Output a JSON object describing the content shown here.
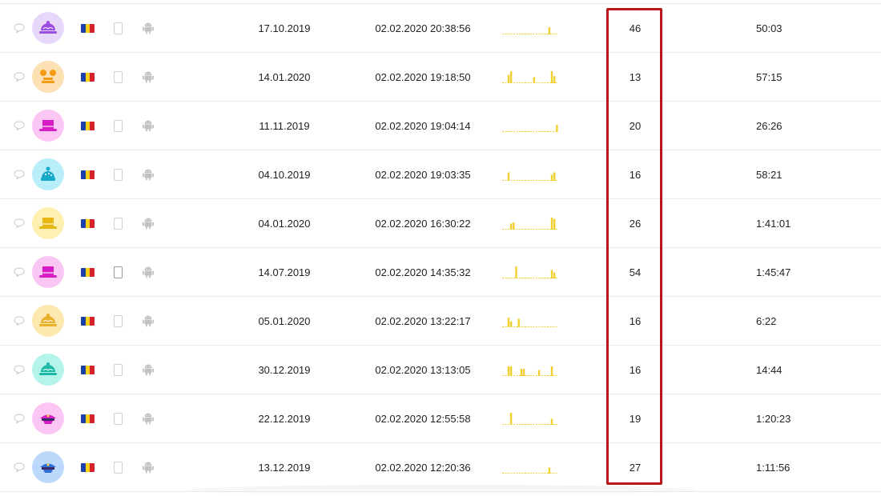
{
  "rows": [
    {
      "first_seen": "17.10.2019",
      "last_seen": "02.02.2020 20:38:56",
      "sessions": "46",
      "duration": "50:03",
      "avatar_color": "#e7d7fb",
      "avatar_fg": "#9a4be0",
      "avatar_icon": "cake-hat-icon",
      "device_active": false,
      "activity": [
        0,
        0,
        0,
        0,
        0,
        0,
        0,
        0,
        0,
        0,
        0,
        0,
        0,
        0,
        0,
        0,
        0,
        0,
        0.6,
        0,
        0,
        0
      ]
    },
    {
      "first_seen": "14.01.2020",
      "last_seen": "02.02.2020 19:18:50",
      "sessions": "13",
      "duration": "57:15",
      "avatar_color": "#fde0b3",
      "avatar_fg": "#f39b12",
      "avatar_icon": "mouse-ears-hat-icon",
      "device_active": false,
      "activity": [
        0,
        0,
        0.7,
        1,
        0,
        0,
        0,
        0,
        0,
        0,
        0,
        0,
        0.5,
        0,
        0,
        0,
        0,
        0,
        0,
        1,
        0.6,
        0
      ]
    },
    {
      "first_seen": "11.11.2019",
      "last_seen": "02.02.2020 19:04:14",
      "sessions": "20",
      "duration": "26:26",
      "avatar_color": "#fbc6f3",
      "avatar_fg": "#d61cc4",
      "avatar_icon": "fedora-hat-icon",
      "device_active": false,
      "activity": [
        0,
        0,
        0,
        0,
        0,
        0,
        0,
        0,
        0,
        0,
        0,
        0,
        0,
        0,
        0,
        0,
        0,
        0,
        0,
        0,
        0,
        0.6
      ]
    },
    {
      "first_seen": "04.10.2019",
      "last_seen": "02.02.2020 19:03:35",
      "sessions": "16",
      "duration": "58:21",
      "avatar_color": "#b8eefa",
      "avatar_fg": "#1aa8c9",
      "avatar_icon": "beanie-hat-icon",
      "device_active": false,
      "activity": [
        0,
        0,
        0.7,
        0,
        0,
        0,
        0,
        0,
        0,
        0,
        0,
        0,
        0,
        0,
        0,
        0,
        0,
        0,
        0,
        0.5,
        0.7,
        0
      ]
    },
    {
      "first_seen": "04.01.2020",
      "last_seen": "02.02.2020 16:30:22",
      "sessions": "26",
      "duration": "1:41:01",
      "avatar_color": "#fdf0b0",
      "avatar_fg": "#e6b710",
      "avatar_icon": "top-hat-icon",
      "device_active": false,
      "activity": [
        0,
        0,
        0,
        0.5,
        0.6,
        0,
        0,
        0,
        0,
        0,
        0,
        0,
        0,
        0,
        0,
        0,
        0,
        0,
        0,
        1,
        0.9,
        0
      ]
    },
    {
      "first_seen": "14.07.2019",
      "last_seen": "02.02.2020 14:35:32",
      "sessions": "54",
      "duration": "1:45:47",
      "avatar_color": "#fbc6f3",
      "avatar_fg": "#d61cc4",
      "avatar_icon": "top-hat-icon",
      "device_active": true,
      "activity": [
        0,
        0,
        0,
        0,
        0,
        1,
        0,
        0,
        0,
        0,
        0,
        0,
        0,
        0,
        0,
        0,
        0,
        0,
        0,
        0.7,
        0.5,
        0
      ]
    },
    {
      "first_seen": "05.01.2020",
      "last_seen": "02.02.2020 13:22:17",
      "sessions": "16",
      "duration": "6:22",
      "avatar_color": "#fde9b0",
      "avatar_fg": "#e9b12b",
      "avatar_icon": "cake-hat-icon",
      "device_active": false,
      "activity": [
        0,
        0,
        0.8,
        0.5,
        0,
        0,
        0.7,
        0,
        0,
        0,
        0,
        0,
        0,
        0,
        0,
        0,
        0,
        0,
        0,
        0,
        0,
        0
      ]
    },
    {
      "first_seen": "30.12.2019",
      "last_seen": "02.02.2020 13:13:05",
      "sessions": "16",
      "duration": "14:44",
      "avatar_color": "#b4f4ea",
      "avatar_fg": "#1bb9a6",
      "avatar_icon": "cake-hat-icon",
      "device_active": false,
      "activity": [
        0,
        0,
        0.8,
        0.8,
        0,
        0,
        0,
        0.6,
        0.6,
        0,
        0,
        0,
        0,
        0,
        0.5,
        0,
        0,
        0,
        0,
        0.8,
        0,
        0
      ]
    },
    {
      "first_seen": "22.12.2019",
      "last_seen": "02.02.2020 12:55:58",
      "sessions": "19",
      "duration": "1:20:23",
      "avatar_color": "#fbc6f3",
      "avatar_fg": "#d61cc4",
      "avatar_icon": "captain-hat-icon",
      "device_active": false,
      "activity": [
        0,
        0,
        0,
        1,
        0,
        0,
        0,
        0,
        0,
        0,
        0,
        0,
        0,
        0,
        0,
        0,
        0,
        0,
        0,
        0.5,
        0,
        0
      ]
    },
    {
      "first_seen": "13.12.2019",
      "last_seen": "02.02.2020 12:20:36",
      "sessions": "27",
      "duration": "1:11:56",
      "avatar_color": "#bcd9fb",
      "avatar_fg": "#2d6fd2",
      "avatar_icon": "captain-hat-icon",
      "device_active": false,
      "activity": [
        0,
        0,
        0,
        0,
        0,
        0,
        0,
        0,
        0,
        0,
        0,
        0,
        0,
        0,
        0,
        0,
        0,
        0,
        0.5,
        0,
        0,
        0
      ]
    }
  ],
  "colors": {
    "flag_blue": "#1d3fa8",
    "flag_yellow": "#f7d116",
    "flag_red": "#d6202a",
    "spark_bar": "#f2cf2d",
    "spark_baseline": "#f2cf2d",
    "highlight_border": "#b8161b",
    "muted_icon": "#c8c8c8"
  },
  "icons": {
    "comment": "speech-bubble-icon",
    "flag": "romania-flag-icon",
    "device": "phone-icon",
    "os": "android-icon"
  }
}
